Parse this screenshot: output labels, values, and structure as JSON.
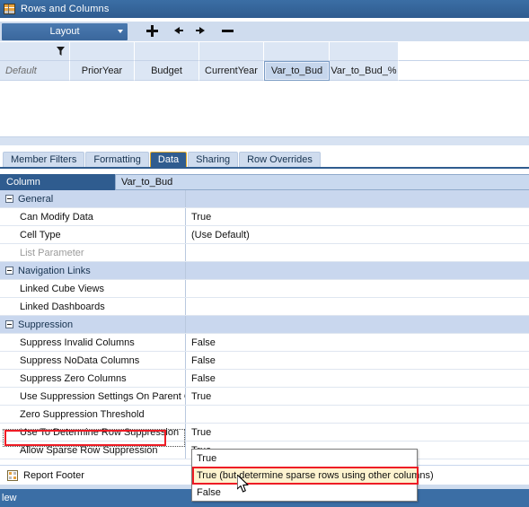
{
  "window": {
    "title": "Rows and Columns",
    "icon": "grid-table-icon"
  },
  "toolbar": {
    "layout_button": "Layout",
    "icons": [
      {
        "name": "add-icon",
        "glyph": "+"
      },
      {
        "name": "move-left-icon",
        "glyph": "←"
      },
      {
        "name": "move-right-icon",
        "glyph": "→"
      },
      {
        "name": "remove-icon",
        "glyph": "−"
      }
    ]
  },
  "column_grid": {
    "filter_icon": "filter-funnel-icon",
    "row_label": "Default",
    "columns": [
      "PriorYear",
      "Budget",
      "CurrentYear",
      "Var_to_Bud",
      "Var_to_Bud_%"
    ],
    "selected_column": "Var_to_Bud"
  },
  "tabs": [
    {
      "label": "Member Filters",
      "active": false
    },
    {
      "label": "Formatting",
      "active": false
    },
    {
      "label": "Data",
      "active": true
    },
    {
      "label": "Sharing",
      "active": false
    },
    {
      "label": "Row Overrides",
      "active": false
    }
  ],
  "column_bar": {
    "label": "Column",
    "value": "Var_to_Bud"
  },
  "properties": [
    {
      "type": "category",
      "name": "General",
      "value": ""
    },
    {
      "type": "property",
      "name": "Can Modify Data",
      "value": "True",
      "disabled": false
    },
    {
      "type": "property",
      "name": "Cell Type",
      "value": "(Use Default)",
      "disabled": false
    },
    {
      "type": "property",
      "name": "List Parameter",
      "value": "",
      "disabled": true
    },
    {
      "type": "category",
      "name": "Navigation Links",
      "value": ""
    },
    {
      "type": "property",
      "name": "Linked Cube Views",
      "value": "",
      "disabled": false
    },
    {
      "type": "property",
      "name": "Linked Dashboards",
      "value": "",
      "disabled": false
    },
    {
      "type": "category",
      "name": "Suppression",
      "value": ""
    },
    {
      "type": "property",
      "name": "Suppress Invalid Columns",
      "value": "False",
      "disabled": false
    },
    {
      "type": "property",
      "name": "Suppress NoData Columns",
      "value": "False",
      "disabled": false
    },
    {
      "type": "property",
      "name": "Suppress Zero Columns",
      "value": "False",
      "disabled": false
    },
    {
      "type": "property",
      "name": "Use Suppression Settings On Parent Colur",
      "value": "True",
      "disabled": false
    },
    {
      "type": "property",
      "name": "Zero Suppression Threshold",
      "value": "",
      "disabled": false
    },
    {
      "type": "property",
      "name": "Use To Determine Row Suppression",
      "value": "True",
      "disabled": false
    },
    {
      "type": "property",
      "name": "Allow Sparse Row Suppression",
      "value": "True",
      "disabled": false,
      "highlighted": true,
      "focused": true
    }
  ],
  "report_footer": {
    "icon": "report-footer-icon",
    "label": "Report Footer"
  },
  "status_bar": {
    "text": "lew"
  },
  "dropdown": {
    "options": [
      {
        "label": "True",
        "highlighted": false
      },
      {
        "label": "True (but determine sparse rows using other columns)",
        "highlighted": true
      },
      {
        "label": "False",
        "highlighted": false
      }
    ]
  },
  "colors": {
    "title_bar": "#3b6ea5",
    "accent_blue": "#2f5c8f",
    "toolbar_bg": "#cfdcee",
    "grid_header": "#dce6f4",
    "category_row": "#c9d7ee",
    "annotation_red": "#ee1c25",
    "highlight_yellow": "#fdf3cf",
    "active_tab_border": "#e0a92a"
  }
}
